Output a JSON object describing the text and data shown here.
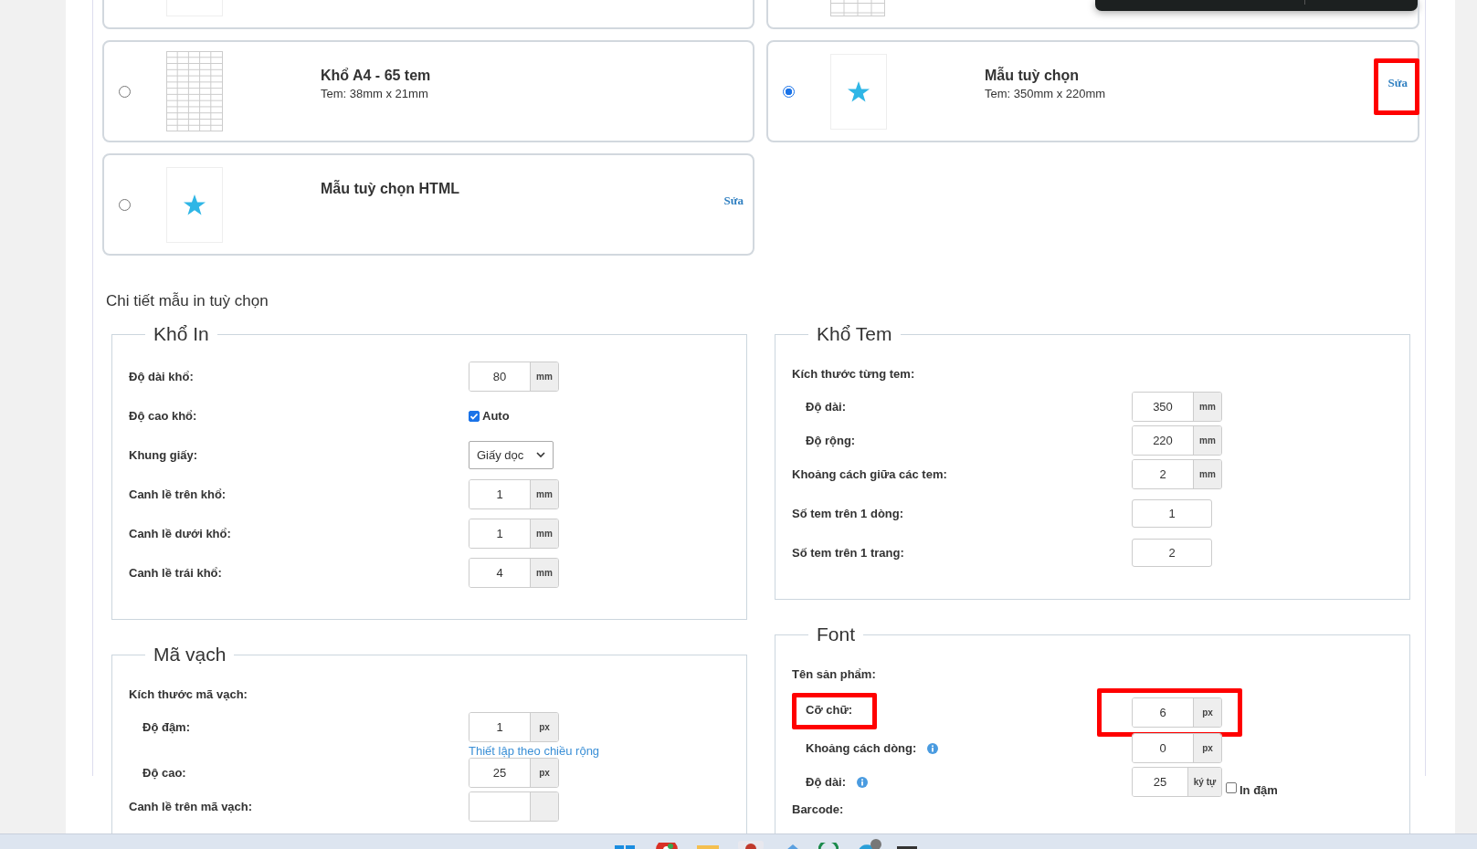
{
  "toast": {
    "kind": "dark"
  },
  "cut_cards": [
    {
      "kind": "blank"
    },
    {
      "kind": "grid"
    }
  ],
  "templates": [
    {
      "title": "Khổ A4 - 65 tem",
      "size": "Tem: 38mm x 21mm",
      "kind": "grid",
      "selected": false
    },
    {
      "title": "Mẫu tuỳ chọn",
      "size": "Tem: 350mm x 220mm",
      "kind": "star",
      "selected": true,
      "edit": "Sửa",
      "highlighted": true
    },
    {
      "title": "Mẫu tuỳ chọn HTML",
      "kind": "star",
      "selected": false,
      "edit": "Sửa",
      "highlighted": false
    }
  ],
  "section_title": "Chi tiết mẫu in tuỳ chọn",
  "columns": [
    [
      {
        "legend": "Khổ In",
        "rows": [
          {
            "kind": "input",
            "label": "Độ dài khổ:",
            "value": "80",
            "unit": "mm"
          },
          {
            "kind": "checkbox",
            "label": "Độ cao khổ:",
            "text": "Auto",
            "checked": true
          },
          {
            "kind": "select",
            "label": "Khung giấy:",
            "value": "Giấy dọc"
          },
          {
            "kind": "input",
            "label": "Canh lề trên khổ:",
            "value": "1",
            "unit": "mm"
          },
          {
            "kind": "input",
            "label": "Canh lề dưới khổ:",
            "value": "1",
            "unit": "mm"
          },
          {
            "kind": "input",
            "label": "Canh lề trái khổ:",
            "value": "4",
            "unit": "mm"
          }
        ]
      },
      {
        "legend": "Mã vạch",
        "rows": [
          {
            "kind": "heading",
            "label": "Kích thước mã vạch:"
          },
          {
            "kind": "input",
            "label": "Độ đậm:",
            "value": "1",
            "unit": "px",
            "indent": true
          },
          {
            "kind": "link",
            "text": "Thiết lập theo chiều rộng"
          },
          {
            "kind": "input",
            "label": "Độ cao:",
            "value": "25",
            "unit": "px",
            "indent": true
          },
          {
            "kind": "input",
            "label": "Canh lề trên mã vạch:",
            "unit": ""
          }
        ]
      }
    ],
    [
      {
        "legend": "Khổ Tem",
        "rows": [
          {
            "kind": "heading",
            "label": "Kích thước từng tem:"
          },
          {
            "kind": "input",
            "label": "Độ dài:",
            "value": "350",
            "unit": "mm",
            "indent": true
          },
          {
            "kind": "input",
            "label": "Độ rộng:",
            "value": "220",
            "unit": "mm",
            "indent": true
          },
          {
            "kind": "input",
            "label": "Khoảng cách giữa các tem:",
            "value": "2",
            "unit": "mm"
          },
          {
            "kind": "input",
            "label": "Số tem trên 1 dòng:",
            "value": "1"
          },
          {
            "kind": "input",
            "label": "Số tem trên 1 trang:",
            "value": "2"
          }
        ]
      },
      {
        "legend": "Font",
        "rows": [
          {
            "kind": "heading",
            "label": "Tên sản phẩm:"
          },
          {
            "kind": "input",
            "label": "Cỡ chữ:",
            "value": "6",
            "unit": "px",
            "indent": true,
            "highlighted": true
          },
          {
            "kind": "input",
            "label": "Khoảng cách dòng:",
            "value": "0",
            "unit": "px",
            "indent": true,
            "info": true
          },
          {
            "kind": "input",
            "label": "Độ dài:",
            "value": "25",
            "unit": "ký tự",
            "indent": true,
            "info": true,
            "check": {
              "text": "In đậm",
              "checked": false
            }
          },
          {
            "kind": "heading",
            "label": "Barcode:"
          }
        ]
      }
    ]
  ],
  "taskbar": {
    "kind": "light"
  }
}
